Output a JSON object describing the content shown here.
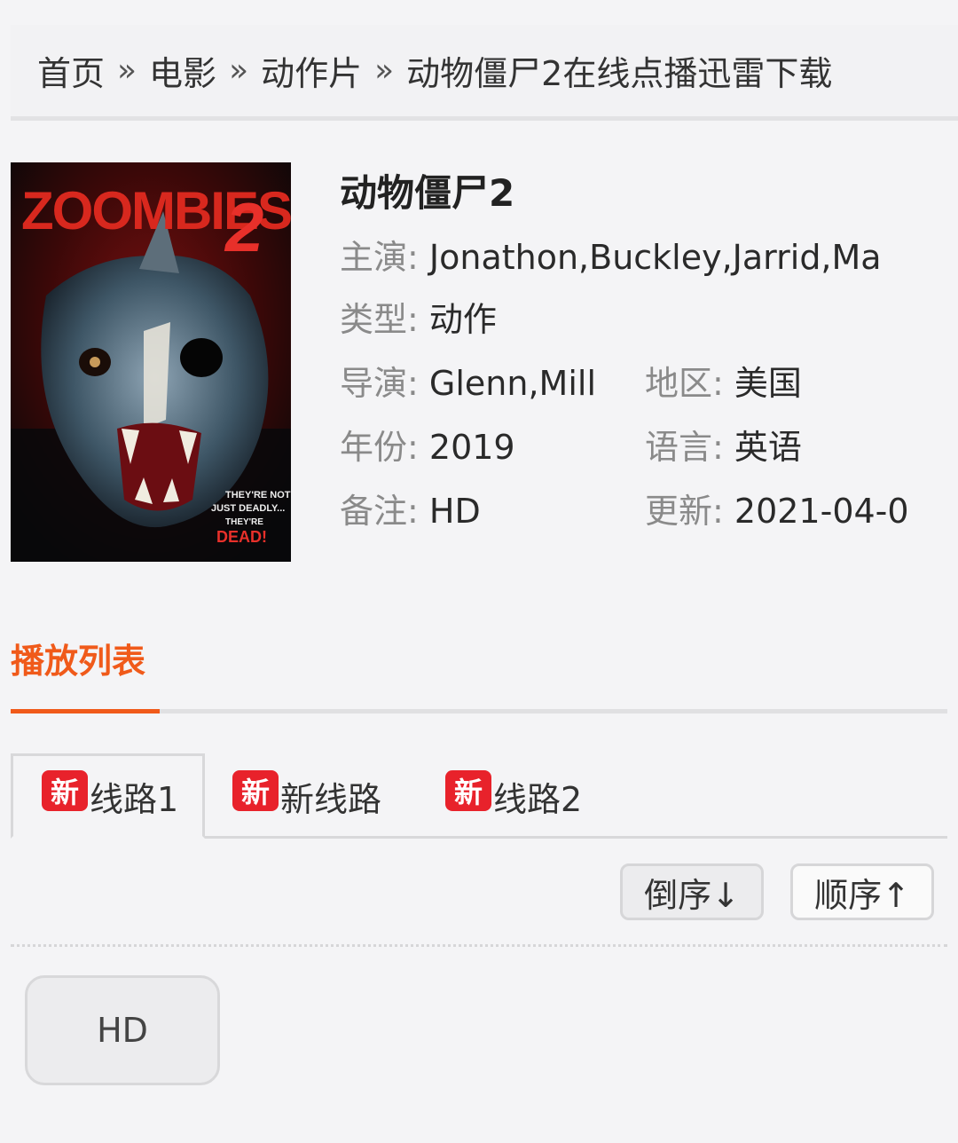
{
  "breadcrumb": {
    "items": [
      "首页",
      "电影",
      "动作片",
      "动物僵尸2在线点播迅雷下载"
    ],
    "separator": "»"
  },
  "poster": {
    "title_text": "ZOOMBIES",
    "number": "2",
    "tagline": [
      "THEY'RE NOT",
      "JUST DEADLY...",
      "THEY'RE",
      "DEAD!"
    ]
  },
  "movie": {
    "title": "动物僵尸2",
    "starring_label": "主演:",
    "starring": "Jonathon,Buckley,Jarrid,Ma",
    "genre_label": "类型:",
    "genre": "动作",
    "director_label": "导演:",
    "director": "Glenn,Mill",
    "region_label": "地区:",
    "region": "美国",
    "year_label": "年份:",
    "year": "2019",
    "language_label": "语言:",
    "language": "英语",
    "note_label": "备注:",
    "note": "HD",
    "updated_label": "更新:",
    "updated": "2021-04-0"
  },
  "playlist": {
    "heading": "播放列表",
    "new_badge": "新",
    "lines": [
      "线路1",
      "新线路",
      "线路2"
    ],
    "active_line": 0,
    "sort_desc": "倒序↓",
    "sort_asc": "顺序↑",
    "episodes": [
      "HD"
    ]
  },
  "colors": {
    "accent": "#f05a1a",
    "badge": "#e8222b",
    "background": "#f4f4f6"
  }
}
